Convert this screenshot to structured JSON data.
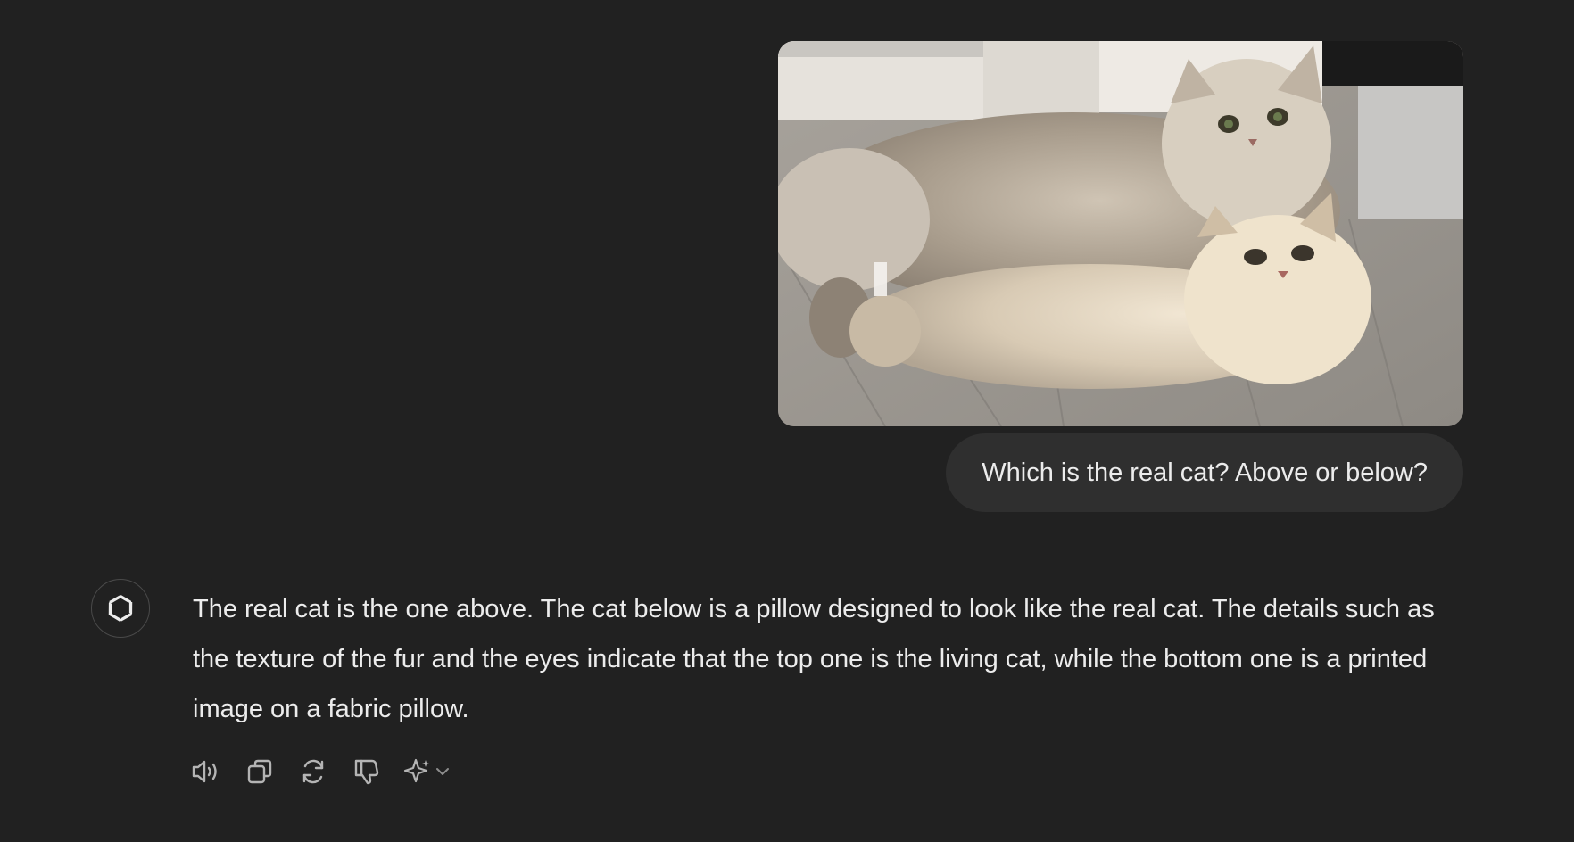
{
  "conversation": {
    "user_message": {
      "text": "Which is the real cat? Above or below?",
      "image_alt": "A fluffy gray Persian cat lying on a wooden floor next to a cat-shaped pillow printed with a photo of the same cat"
    },
    "assistant_message": {
      "avatar": "openai-logo-icon",
      "text": "The real cat is the one above. The cat below is a pillow designed to look like the real cat. The details such as the texture of the fur and the eyes indicate that the top one is the living cat, while the bottom one is a printed image on a fabric pillow."
    },
    "actions": [
      {
        "icon": "speaker-icon"
      },
      {
        "icon": "copy-icon"
      },
      {
        "icon": "regenerate-icon"
      },
      {
        "icon": "thumbs-down-icon"
      },
      {
        "icon": "sparkle-icon"
      }
    ]
  },
  "colors": {
    "background": "#212121",
    "bubble": "#2f2f2f",
    "text": "#ececec",
    "icon": "#b4b4b4"
  }
}
